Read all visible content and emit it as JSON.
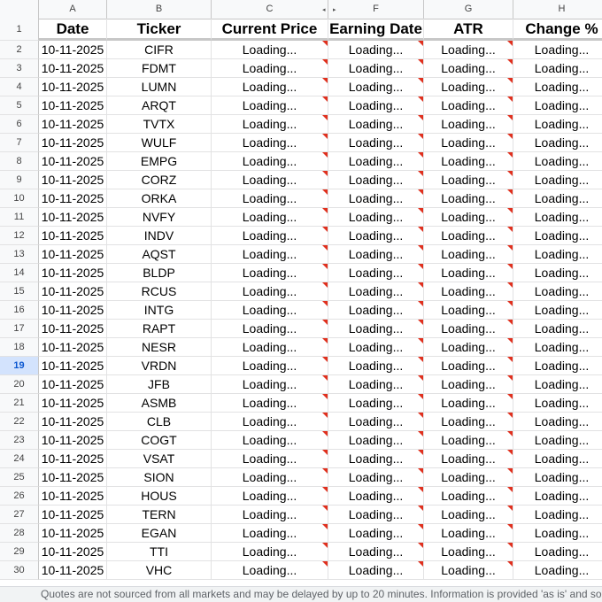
{
  "columns": [
    {
      "letter": "A",
      "header": "Date"
    },
    {
      "letter": "B",
      "header": "Ticker"
    },
    {
      "letter": "C",
      "header": "Current Price"
    },
    {
      "letter": "F",
      "header": "Earning Date"
    },
    {
      "letter": "G",
      "header": "ATR"
    },
    {
      "letter": "H",
      "header": "Change %"
    }
  ],
  "active_row": "19",
  "loading_text": "Loading...",
  "rows": [
    {
      "n": "2",
      "date": "10-11-2025",
      "ticker": "CIFR"
    },
    {
      "n": "3",
      "date": "10-11-2025",
      "ticker": "FDMT"
    },
    {
      "n": "4",
      "date": "10-11-2025",
      "ticker": "LUMN"
    },
    {
      "n": "5",
      "date": "10-11-2025",
      "ticker": "ARQT"
    },
    {
      "n": "6",
      "date": "10-11-2025",
      "ticker": "TVTX"
    },
    {
      "n": "7",
      "date": "10-11-2025",
      "ticker": "WULF"
    },
    {
      "n": "8",
      "date": "10-11-2025",
      "ticker": "EMPG"
    },
    {
      "n": "9",
      "date": "10-11-2025",
      "ticker": "CORZ"
    },
    {
      "n": "10",
      "date": "10-11-2025",
      "ticker": "ORKA"
    },
    {
      "n": "11",
      "date": "10-11-2025",
      "ticker": "NVFY"
    },
    {
      "n": "12",
      "date": "10-11-2025",
      "ticker": "INDV"
    },
    {
      "n": "13",
      "date": "10-11-2025",
      "ticker": "AQST"
    },
    {
      "n": "14",
      "date": "10-11-2025",
      "ticker": "BLDP"
    },
    {
      "n": "15",
      "date": "10-11-2025",
      "ticker": "RCUS"
    },
    {
      "n": "16",
      "date": "10-11-2025",
      "ticker": "INTG"
    },
    {
      "n": "17",
      "date": "10-11-2025",
      "ticker": "RAPT"
    },
    {
      "n": "18",
      "date": "10-11-2025",
      "ticker": "NESR"
    },
    {
      "n": "19",
      "date": "10-11-2025",
      "ticker": "VRDN"
    },
    {
      "n": "20",
      "date": "10-11-2025",
      "ticker": "JFB"
    },
    {
      "n": "21",
      "date": "10-11-2025",
      "ticker": "ASMB"
    },
    {
      "n": "22",
      "date": "10-11-2025",
      "ticker": "CLB"
    },
    {
      "n": "23",
      "date": "10-11-2025",
      "ticker": "COGT"
    },
    {
      "n": "24",
      "date": "10-11-2025",
      "ticker": "VSAT"
    },
    {
      "n": "25",
      "date": "10-11-2025",
      "ticker": "SION"
    },
    {
      "n": "26",
      "date": "10-11-2025",
      "ticker": "HOUS"
    },
    {
      "n": "27",
      "date": "10-11-2025",
      "ticker": "TERN"
    },
    {
      "n": "28",
      "date": "10-11-2025",
      "ticker": "EGAN"
    },
    {
      "n": "29",
      "date": "10-11-2025",
      "ticker": "TTI"
    },
    {
      "n": "30",
      "date": "10-11-2025",
      "ticker": "VHC"
    }
  ],
  "header_row_number": "1",
  "footer_text": "Quotes are not sourced from all markets and may be delayed by up to 20 minutes. Information is provided 'as is' and solely for info",
  "colors": {
    "error_marker": "#e0301e",
    "active_row_bg": "#d3e3fd",
    "active_row_text": "#0b57d0"
  }
}
